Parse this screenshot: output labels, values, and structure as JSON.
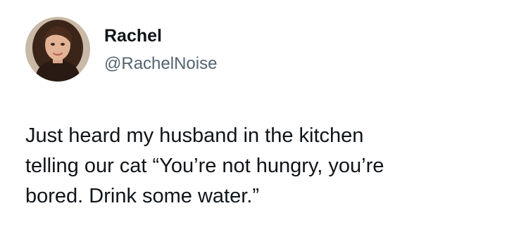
{
  "author": {
    "display_name": "Rachel",
    "handle": "@RachelNoise",
    "avatar_icon": "profile-photo"
  },
  "tweet": {
    "lines": [
      "Just heard my husband in the kitchen",
      "telling our cat “You’re not hungry, you’re",
      "bored. Drink some water.”"
    ]
  },
  "colors": {
    "text_primary": "#0f1419",
    "text_secondary": "#536471",
    "background": "#ffffff"
  }
}
